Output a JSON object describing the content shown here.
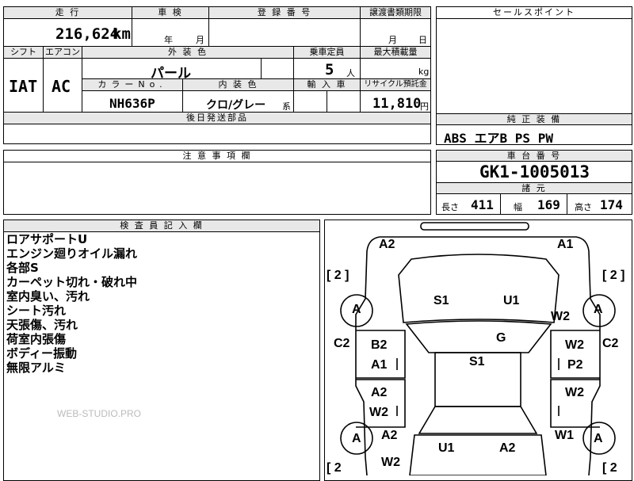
{
  "headers": {
    "mileage": "走 行",
    "inspection": "車 検",
    "registration": "登 録 番 号",
    "transfer_deadline": "譲渡書類期限",
    "sales_point": "セールスポイント",
    "shift": "シフト",
    "aircon": "エアコン",
    "exterior_color": "外 装 色",
    "capacity": "乗車定員",
    "max_load": "最大積載量",
    "color_no": "カラーNo.",
    "interior_color": "内 装 色",
    "import_car": "輸 入 車",
    "recycle_fee": "リサイクル預託金",
    "later_parts": "後日発送部品",
    "equipment": "純 正 装 備",
    "caution": "注 意 事 項 欄",
    "chassis_no": "車 台 番 号",
    "specs": "諸 元",
    "inspector_notes": "検 査 員 記 入 欄"
  },
  "vehicle": {
    "mileage": "216,624",
    "mileage_unit": "km",
    "inspection_year_unit": "年",
    "inspection_month_unit": "月",
    "transfer_month_unit": "月",
    "transfer_day_unit": "日",
    "shift": "IAT",
    "aircon": "AC",
    "exterior_color": "パール",
    "capacity": "5",
    "capacity_unit": "人",
    "max_load_unit": "kg",
    "color_no": "NH636P",
    "interior_color": "クロ/グレー",
    "interior_suffix": "系",
    "recycle_fee": "11,810",
    "recycle_unit": "円",
    "equipment": "ABS エアB PS PW",
    "chassis_no": "GK1-1005013",
    "length_label": "長さ",
    "length": "411",
    "width_label": "幅",
    "width": "169",
    "height_label": "高さ",
    "height": "174"
  },
  "notes": [
    "ロアサポートU",
    "エンジン廻りオイル漏れ",
    "各部S",
    "カーペット切れ・破れ中",
    "室内臭い、汚れ",
    "シート汚れ",
    "天張傷、汚れ",
    "荷室内張傷",
    "ボディー振動",
    "無限アルミ"
  ],
  "watermark": "WEB-STUDIO.PRO",
  "diagram": {
    "front_left": "A2",
    "front_right": "A1",
    "tire_count_fl": "[ 2 ]",
    "tire_count_fr": "[ 2 ]",
    "tire_count_rl": "[ 2",
    "tire_count_rr": "[ 2",
    "tire_fl": "A",
    "tire_fr": "A",
    "tire_rl": "A",
    "tire_rr": "A",
    "hood_left": "S1",
    "hood_right": "U1",
    "fender_right": "W2",
    "windshield": "G",
    "roof": "S1",
    "pillar_left": "C2",
    "pillar_right": "C2",
    "front_door_left_1": "B2",
    "front_door_left_2": "A1",
    "front_door_right_1": "W2",
    "front_door_right_2": "P2",
    "rear_door_left_1": "A2",
    "rear_door_left_2": "W2",
    "rear_door_right": "W2",
    "rear_fender_left": "A2",
    "rear_fender_right": "W1",
    "rear_left": "W2",
    "tail_left": "U1",
    "tail_right": "A2"
  }
}
